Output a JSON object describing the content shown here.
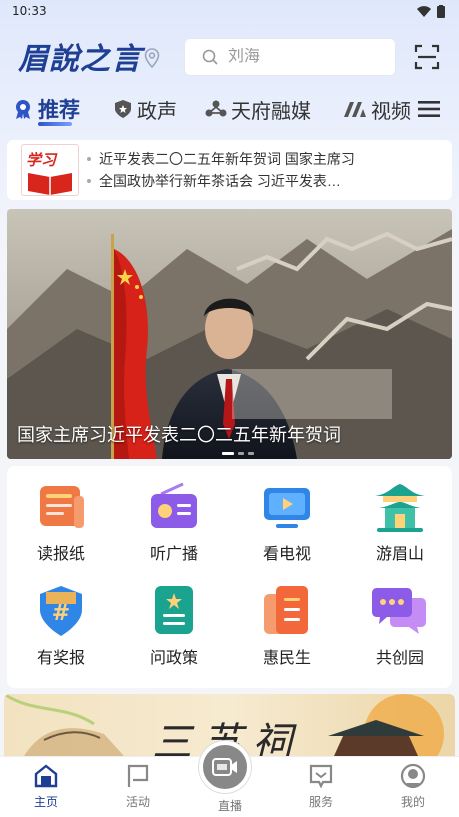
{
  "status_bar": {
    "time": "10:33"
  },
  "header": {
    "logo_text": "眉說之言",
    "search": {
      "placeholder": "刘海"
    }
  },
  "tabs": [
    {
      "label": "推荐",
      "active": true,
      "icon": "ribbon-icon"
    },
    {
      "label": "政声",
      "active": false,
      "icon": "shield-star-icon"
    },
    {
      "label": "天府融媒",
      "active": false,
      "icon": "network-icon"
    },
    {
      "label": "视频",
      "active": false,
      "icon": "video-logo-icon"
    }
  ],
  "news": {
    "logo_text": "学习",
    "items": [
      "近平发表二〇二五年新年贺词 国家主席习",
      "全国政协举行新年茶话会 习近平发表…"
    ]
  },
  "banner": {
    "caption": "国家主席习近平发表二〇二五年新年贺词"
  },
  "services": [
    {
      "label": "读报纸",
      "icon": "newspaper-icon"
    },
    {
      "label": "听广播",
      "icon": "radio-icon"
    },
    {
      "label": "看电视",
      "icon": "tv-icon"
    },
    {
      "label": "游眉山",
      "icon": "pavilion-icon"
    },
    {
      "label": "有奖报",
      "icon": "hashtag-shield-icon"
    },
    {
      "label": "问政策",
      "icon": "policy-doc-icon"
    },
    {
      "label": "惠民生",
      "icon": "files-icon"
    },
    {
      "label": "共创园",
      "icon": "chat-bubbles-icon"
    }
  ],
  "promo": {
    "title": "三苏祠"
  },
  "bottom_nav": [
    {
      "label": "主页",
      "active": true
    },
    {
      "label": "活动",
      "active": false
    },
    {
      "label": "直播",
      "active": false
    },
    {
      "label": "服务",
      "active": false
    },
    {
      "label": "我的",
      "active": false
    }
  ],
  "colors": {
    "brand": "#1f3f94",
    "accent_orange": "#f2683a",
    "teal": "#1aa38e",
    "purple": "#8c5ce8"
  }
}
